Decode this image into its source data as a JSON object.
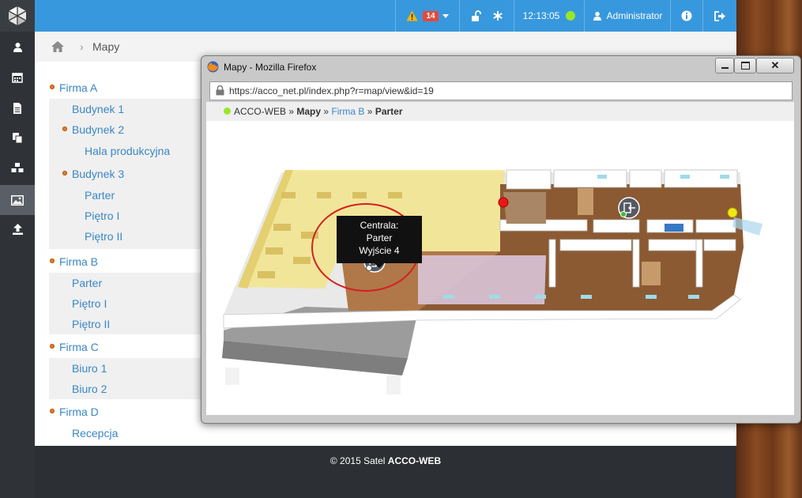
{
  "topbar": {
    "alert_count": "14",
    "clock": "12:13:05",
    "user": "Administrator"
  },
  "breadcrumb": {
    "current": "Mapy"
  },
  "tree": {
    "firma_a": "Firma A",
    "budynek_1": "Budynek 1",
    "budynek_2": "Budynek 2",
    "hala": "Hala produkcyjna",
    "budynek_3": "Budynek 3",
    "b3_parter": "Parter",
    "b3_pietro1": "Piętro I",
    "b3_pietro2": "Piętro II",
    "firma_b": "Firma B",
    "fb_parter": "Parter",
    "fb_pietro1": "Piętro I",
    "fb_pietro2": "Piętro II",
    "firma_c": "Firma C",
    "biuro_1": "Biuro 1",
    "biuro_2": "Biuro 2",
    "firma_d": "Firma D",
    "recepcja": "Recepcja"
  },
  "footer": {
    "copyright": "© 2015 Satel",
    "brand": "ACCO-WEB"
  },
  "firefox": {
    "title": "Mapy - Mozilla Firefox",
    "url": "https://acco_net.pl/index.php?r=map/view&id=19",
    "crumb_root": "ACCO-WEB",
    "crumb_sep": "»",
    "crumb_mapy": "Mapy",
    "crumb_firma": "Firma B",
    "crumb_current": "Parter"
  },
  "tooltip": {
    "line1": "Centrala:",
    "line2": "Parter",
    "line3": "Wyjście 4"
  },
  "colors": {
    "topbar": "#3898dd",
    "sidebar": "#2f3237",
    "link": "#3a87c8",
    "status_ok": "#9ae62a"
  },
  "icons": {
    "sidebar": [
      "user-icon",
      "calendar-icon",
      "document-icon",
      "copy-icon",
      "cubes-icon",
      "image-icon",
      "upload-icon"
    ],
    "topbar": [
      "warning-icon",
      "unlock-icon",
      "asterisk-icon",
      "user-icon",
      "info-icon",
      "logout-icon"
    ]
  }
}
